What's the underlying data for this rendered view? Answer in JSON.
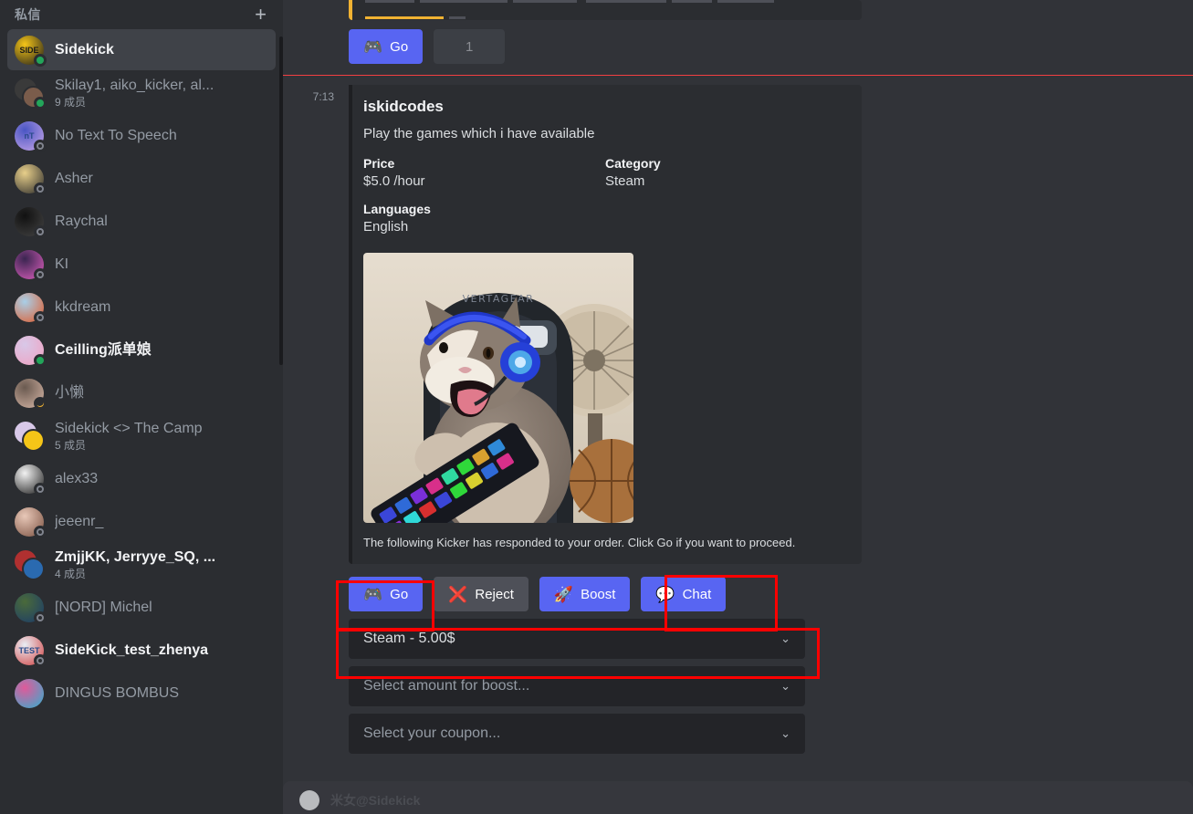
{
  "sidebar": {
    "header_title": "私信",
    "add_icon": "+",
    "items": [
      {
        "name": "Sidekick",
        "sub": "",
        "status": "online",
        "active": true,
        "unread": true,
        "avatar_kind": "single",
        "avatar_colors": [
          "#f5c518",
          "#1a1a1a"
        ],
        "avatar_text": "SIDE"
      },
      {
        "name": "Skilay1, aiko_kicker, al...",
        "sub": "9 成员",
        "status": "online",
        "active": false,
        "unread": false,
        "avatar_kind": "group",
        "avatar_colors": [
          "#3a3a3a",
          "#7a5c4b"
        ],
        "avatar_text": ""
      },
      {
        "name": "No Text To Speech",
        "sub": "",
        "status": "offline",
        "active": false,
        "unread": false,
        "avatar_kind": "single",
        "avatar_colors": [
          "#4a56c4",
          "#c9a7e8"
        ],
        "avatar_text": "nT"
      },
      {
        "name": "Asher",
        "sub": "",
        "status": "offline",
        "active": false,
        "unread": false,
        "avatar_kind": "single",
        "avatar_colors": [
          "#e8cf8a",
          "#2a2a2a"
        ],
        "avatar_text": ""
      },
      {
        "name": "Raychal",
        "sub": "",
        "status": "offline",
        "active": false,
        "unread": false,
        "avatar_kind": "single",
        "avatar_colors": [
          "#111111",
          "#444444"
        ],
        "avatar_text": ""
      },
      {
        "name": "KI",
        "sub": "",
        "status": "offline",
        "active": false,
        "unread": false,
        "avatar_kind": "single",
        "avatar_colors": [
          "#3a2550",
          "#e060c0"
        ],
        "avatar_text": ""
      },
      {
        "name": "kkdream",
        "sub": "",
        "status": "offline",
        "active": false,
        "unread": false,
        "avatar_kind": "single",
        "avatar_colors": [
          "#a9cfe8",
          "#e05a2a"
        ],
        "avatar_text": ""
      },
      {
        "name": "Ceilling派单娘",
        "sub": "",
        "status": "online",
        "active": false,
        "unread": true,
        "avatar_kind": "single",
        "avatar_colors": [
          "#d8c8e8",
          "#f0a0c0"
        ],
        "avatar_text": ""
      },
      {
        "name": "小懒",
        "sub": "",
        "status": "idle",
        "active": false,
        "unread": false,
        "avatar_kind": "single",
        "avatar_colors": [
          "#6a5a50",
          "#d8b8a8"
        ],
        "avatar_text": ""
      },
      {
        "name": "Sidekick <> The Camp",
        "sub": "5 成员",
        "status": "none",
        "active": false,
        "unread": false,
        "avatar_kind": "group",
        "avatar_colors": [
          "#d8c8e8",
          "#f5c518"
        ],
        "avatar_text": ""
      },
      {
        "name": "alex33",
        "sub": "",
        "status": "offline",
        "active": false,
        "unread": false,
        "avatar_kind": "single",
        "avatar_colors": [
          "#f2f2f2",
          "#1a1a1a"
        ],
        "avatar_text": ""
      },
      {
        "name": "jeeenr_",
        "sub": "",
        "status": "offline",
        "active": false,
        "unread": false,
        "avatar_kind": "single",
        "avatar_colors": [
          "#e8c8b8",
          "#7a5040"
        ],
        "avatar_text": ""
      },
      {
        "name": "ZmjjKK, Jerryye_SQ, ...",
        "sub": "4 成员",
        "status": "none",
        "active": false,
        "unread": true,
        "avatar_kind": "group",
        "avatar_colors": [
          "#b03030",
          "#2a6ab0"
        ],
        "avatar_text": ""
      },
      {
        "name": "[NORD] Michel",
        "sub": "",
        "status": "offline",
        "active": false,
        "unread": false,
        "avatar_kind": "single",
        "avatar_colors": [
          "#4a6a3a",
          "#1a3a6a"
        ],
        "avatar_text": ""
      },
      {
        "name": "SideKick_test_zhenya",
        "sub": "",
        "status": "offline",
        "active": false,
        "unread": true,
        "avatar_kind": "single",
        "avatar_colors": [
          "#eaeef5",
          "#d04040"
        ],
        "avatar_text": "TEST"
      },
      {
        "name": "DINGUS BOMBUS",
        "sub": "",
        "status": "none",
        "active": false,
        "unread": false,
        "avatar_kind": "single",
        "avatar_colors": [
          "#e05a9a",
          "#30b0d0"
        ],
        "avatar_text": ""
      }
    ]
  },
  "top_message": {
    "go_label": "Go",
    "go_icon": "🎮",
    "counter_label": "1"
  },
  "message": {
    "timestamp": "7:13",
    "embed": {
      "title": "iskidcodes",
      "description": "Play the games which i have available",
      "fields": [
        {
          "name": "Price",
          "value": "$5.0 /hour"
        },
        {
          "name": "Category",
          "value": "Steam"
        },
        {
          "name": "Languages",
          "value": "English"
        }
      ],
      "image_alt": "cat-with-headphones-gaming-chair",
      "footer": "The following Kicker has responded to your order. Click Go if you want to proceed."
    },
    "actions": [
      {
        "label": "Go",
        "icon": "🎮",
        "style": "primary",
        "highlighted": true
      },
      {
        "label": "Reject",
        "icon": "❌",
        "style": "secondary",
        "highlighted": false
      },
      {
        "label": "Boost",
        "icon": "🚀",
        "style": "primary",
        "highlighted": false
      },
      {
        "label": "Chat",
        "icon": "💬",
        "style": "primary",
        "highlighted": true
      }
    ],
    "selects": [
      {
        "value": "Steam - 5.00$",
        "filled": true,
        "highlighted": true,
        "chevron": "⌄"
      },
      {
        "value": "Select amount for boost...",
        "filled": false,
        "highlighted": false,
        "chevron": "⌄"
      },
      {
        "value": "Select your coupon...",
        "filled": false,
        "highlighted": false,
        "chevron": "⌄"
      }
    ]
  },
  "bottom_message": {
    "text": "米女@Sidekick"
  },
  "colors": {
    "accent_blurple": "#5865f2",
    "annotation_red": "#ff0000",
    "new_messages_divider": "#f23f42",
    "online_green": "#23a55a",
    "idle_yellow": "#f0b232",
    "sidebar_bg": "#2b2d31",
    "main_bg": "#313338",
    "embed_bg": "#2b2d31"
  }
}
